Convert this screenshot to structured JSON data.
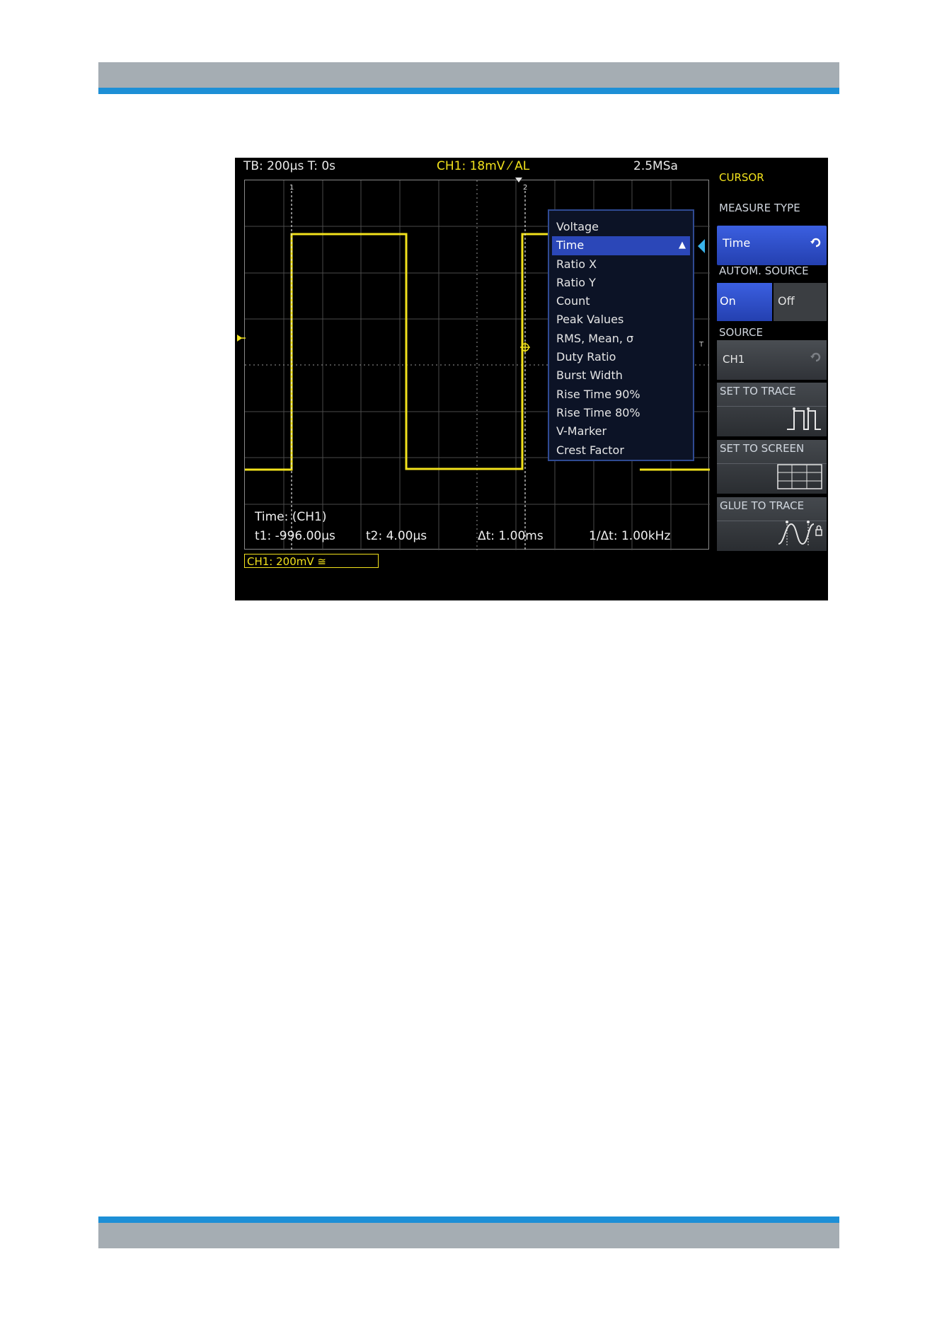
{
  "header_band_colors": {
    "grey": "#a5adb3",
    "blue": "#1d8fd6"
  },
  "scope": {
    "status_bar": {
      "timebase": "TB: 200µs  T: 0s",
      "ch1_trigger": "CH1: 18mV ⁄ AL",
      "sample_rate": "2.5MSa"
    },
    "trace_color": "#f2e21c",
    "cursor_markers": {
      "cursor1_label": "1",
      "cursor2_label": "2",
      "trigger_level_label": "T"
    },
    "readout": {
      "title": "Time: (CH1)",
      "t1": "t1: -996.00µs",
      "t2": "t2: 4.00µs",
      "delta_t": "Δt: 1.00ms",
      "inverse_delta_t": "1/Δt: 1.00kHz"
    },
    "channel_badge": "CH1: 200mV ≅",
    "measure_type_menu": {
      "items": [
        "Voltage",
        "Time",
        "Ratio X",
        "Ratio Y",
        "Count",
        "Peak Values",
        "RMS, Mean, σ",
        "Duty Ratio",
        "Burst Width",
        "Rise Time 90%",
        "Rise Time 80%",
        "V-Marker",
        "Crest Factor"
      ],
      "selected": "Time",
      "selected_color": "#2b47b8"
    }
  },
  "side_panel": {
    "title": "CURSOR",
    "measure_type": {
      "label": "MEASURE TYPE",
      "value": "Time"
    },
    "autom_source": {
      "label": "AUTOM. SOURCE",
      "on": "On",
      "off": "Off",
      "active": "On"
    },
    "source": {
      "label": "SOURCE",
      "value": "CH1"
    },
    "set_to_trace": {
      "label": "SET TO TRACE",
      "icon": "set-to-trace-icon"
    },
    "set_to_screen": {
      "label": "SET TO SCREEN",
      "icon": "set-to-screen-icon"
    },
    "glue_to_trace": {
      "label": "GLUE TO TRACE",
      "icon": "glue-to-trace-icon"
    }
  }
}
